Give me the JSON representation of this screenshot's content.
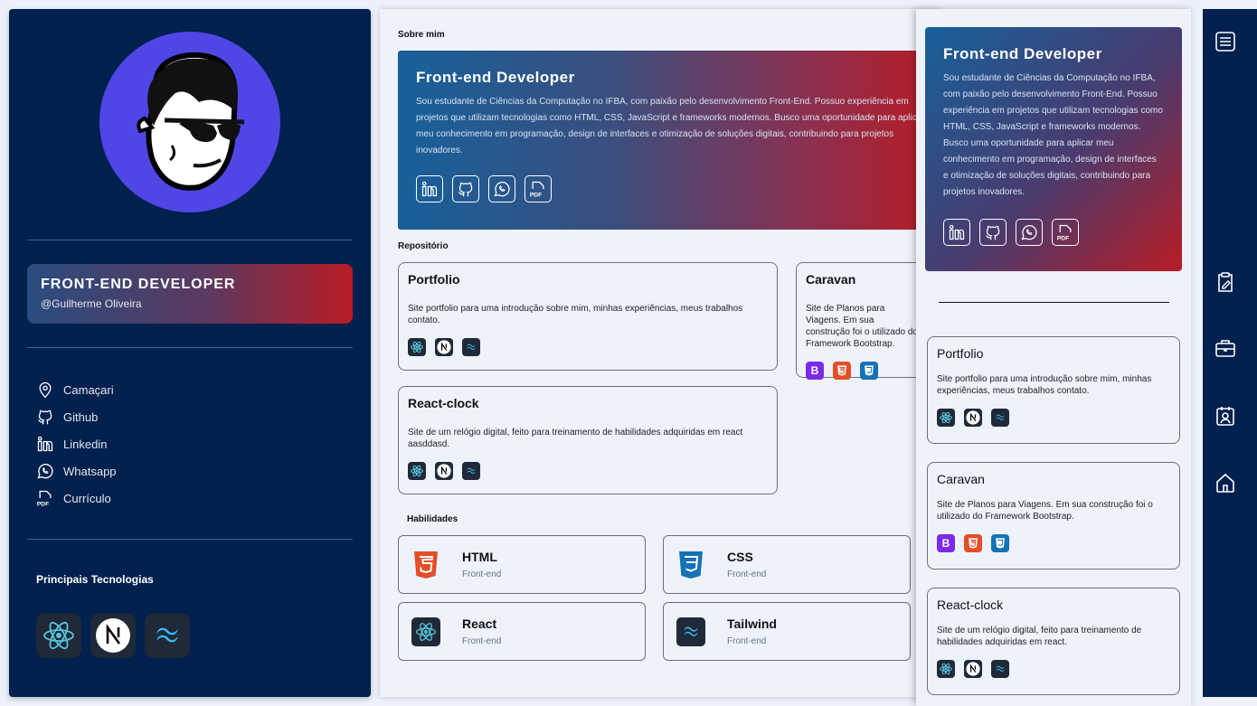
{
  "sidebar": {
    "dev_title": "FRONT-END DEVELOPER",
    "handle": "@Guilherme Oliveira",
    "contacts": [
      {
        "label": "Camaçari",
        "icon": "location-pin-icon"
      },
      {
        "label": "Github",
        "icon": "github-icon"
      },
      {
        "label": "Linkedin",
        "icon": "linkedin-icon"
      },
      {
        "label": "Whatsapp",
        "icon": "whatsapp-icon"
      },
      {
        "label": "Currículo",
        "icon": "pdf-icon"
      }
    ],
    "tech_title": "Principais Tecnologias",
    "techs": [
      "react-icon",
      "nextjs-icon",
      "tailwind-icon"
    ]
  },
  "main": {
    "about_heading": "Sobre mim",
    "about_title": "Front-end Developer",
    "about_text": "Sou estudante de Ciências da Computação no IFBA, com paixão pelo desenvolvimento Front-End. Possuo experiência em projetos que utilizam tecnologias como HTML, CSS, JavaScript e frameworks modernos. Busco uma oportunidade para aplicar meu conhecimento em programação, design de interfaces e otimização de soluções digitais, contribuindo para projetos inovadores.",
    "repo_heading": "Repositório",
    "repos": [
      {
        "name": "Portfolio",
        "desc": "Site portfolio para uma introdução sobre mim, minhas experiências, meus trabalhos contato.",
        "techs": [
          "react-icon",
          "nextjs-icon",
          "tailwind-icon"
        ]
      },
      {
        "name": "Caravan",
        "desc": "Site de Planos para Viagens. Em sua construção foi o utilizado do Framework Bootstrap.",
        "techs": [
          "bootstrap-icon",
          "html5-icon",
          "css3-icon"
        ]
      },
      {
        "name": "React-clock",
        "desc": "Site de um relógio digital, feito para treinamento de habilidades adquiridas em react aasddasd.",
        "techs": [
          "react-icon",
          "nextjs-icon",
          "tailwind-icon"
        ]
      }
    ],
    "skills_heading": "Habilidades",
    "skills": [
      {
        "name": "HTML",
        "sub": "Front-end",
        "icon": "html5-icon"
      },
      {
        "name": "CSS",
        "sub": "Front-end",
        "icon": "css3-icon"
      },
      {
        "name": "React",
        "sub": "Front-end",
        "icon": "react-icon"
      },
      {
        "name": "Tailwind",
        "sub": "Front-end",
        "icon": "tailwind-icon"
      }
    ]
  },
  "panel": {
    "about_title": "Front-end Developer",
    "about_text": "Sou estudante de Ciências da Computação no IFBA, com paixão pelo desenvolvimento Front-End. Possuo experiência em projetos que utilizam tecnologias como HTML, CSS, JavaScript e frameworks modernos. Busco uma oportunidade para aplicar meu conhecimento em programação, design de interfaces e otimização de soluções digitais, contribuindo para projetos inovadores.",
    "repos": [
      {
        "name": "Portfolio",
        "desc": "Site portfolio para uma introdução sobre mim, minhas experiências, meus trabalhos contato."
      },
      {
        "name": "Caravan",
        "desc": "Site de Planos para Viagens. Em sua construção foi o utilizado do Framework Bootstrap."
      },
      {
        "name": "React-clock",
        "desc": "Site de um relógio digital, feito para treinamento de habilidades adquiridas em react."
      }
    ]
  },
  "nav": {
    "items": [
      "menu-icon",
      "clipboard-icon",
      "briefcase-icon",
      "contact-card-icon",
      "home-icon"
    ]
  },
  "colors": {
    "navy": "#00204E",
    "accent_red": "#B91C25",
    "accent_blue": "#17609B",
    "avatar_bg": "#4F46E5"
  }
}
